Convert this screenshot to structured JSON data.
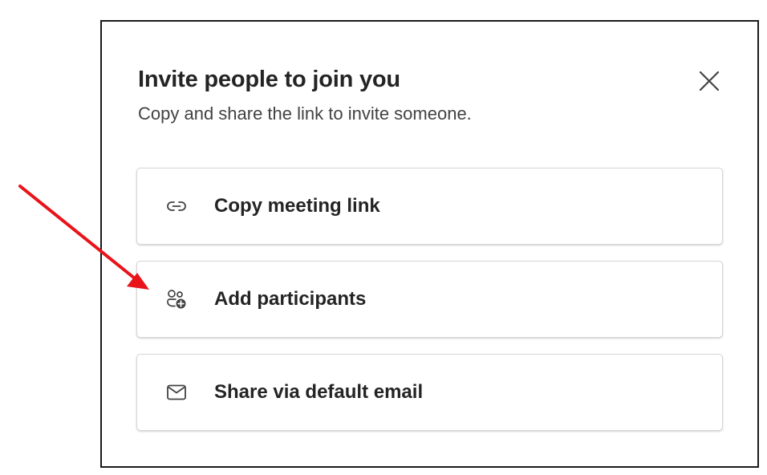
{
  "dialog": {
    "title": "Invite people to join you",
    "subtitle": "Copy and share the link to invite someone.",
    "close_icon": "close-icon",
    "options": [
      {
        "label": "Copy meeting link",
        "icon": "link-icon"
      },
      {
        "label": "Add participants",
        "icon": "add-people-icon"
      },
      {
        "label": "Share via default email",
        "icon": "mail-icon"
      }
    ]
  },
  "annotation": {
    "arrow_color": "#e8141a",
    "arrow_icon": "red-arrow-icon"
  }
}
